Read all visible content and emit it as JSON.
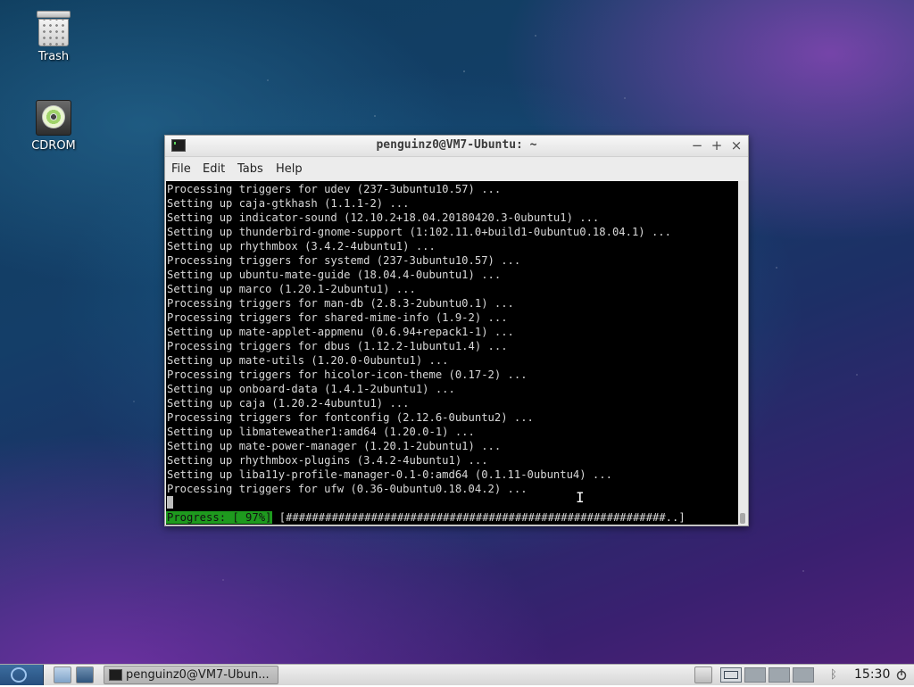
{
  "desktop": {
    "icons": [
      {
        "label": "Trash",
        "icon": "trash-icon"
      },
      {
        "label": "CDROM",
        "icon": "cdrom-icon"
      }
    ]
  },
  "terminal": {
    "title": "penguinz0@VM7-Ubuntu: ~",
    "controls": {
      "minimize": "−",
      "maximize": "+",
      "close": "×"
    },
    "menu": {
      "file": "File",
      "edit": "Edit",
      "tabs": "Tabs",
      "help": "Help"
    },
    "lines": [
      "Processing triggers for udev (237-3ubuntu10.57) ...",
      "Setting up caja-gtkhash (1.1.1-2) ...",
      "Setting up indicator-sound (12.10.2+18.04.20180420.3-0ubuntu1) ...",
      "Setting up thunderbird-gnome-support (1:102.11.0+build1-0ubuntu0.18.04.1) ...",
      "Setting up rhythmbox (3.4.2-4ubuntu1) ...",
      "Processing triggers for systemd (237-3ubuntu10.57) ...",
      "Setting up ubuntu-mate-guide (18.04.4-0ubuntu1) ...",
      "Setting up marco (1.20.1-2ubuntu1) ...",
      "Processing triggers for man-db (2.8.3-2ubuntu0.1) ...",
      "Processing triggers for shared-mime-info (1.9-2) ...",
      "Setting up mate-applet-appmenu (0.6.94+repack1-1) ...",
      "Processing triggers for dbus (1.12.2-1ubuntu1.4) ...",
      "Setting up mate-utils (1.20.0-0ubuntu1) ...",
      "Processing triggers for hicolor-icon-theme (0.17-2) ...",
      "Setting up onboard-data (1.4.1-2ubuntu1) ...",
      "Setting up caja (1.20.2-4ubuntu1) ...",
      "Processing triggers for fontconfig (2.12.6-0ubuntu2) ...",
      "Setting up libmateweather1:amd64 (1.20.0-1) ...",
      "Setting up mate-power-manager (1.20.1-2ubuntu1) ...",
      "Setting up rhythmbox-plugins (3.4.2-4ubuntu1) ...",
      "Setting up liba11y-profile-manager-0.1-0:amd64 (0.1.11-0ubuntu4) ...",
      "Processing triggers for ufw (0.36-0ubuntu0.18.04.2) ..."
    ],
    "progress": {
      "label": "Progress: [ 97%]",
      "bar": " [##########################################################..]",
      "percent": 97
    }
  },
  "taskbar": {
    "window_button": "penguinz0@VM7-Ubun...",
    "clock": "15:30",
    "workspaces": 4,
    "active_workspace": 1
  }
}
